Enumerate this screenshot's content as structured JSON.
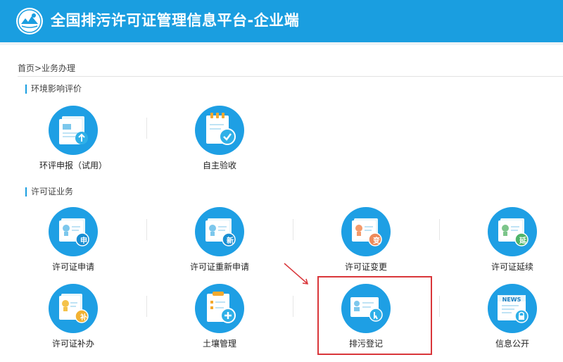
{
  "header": {
    "title": "全国排污许可证管理信息平台-企业端",
    "logo_icon": "ministry-emblem-icon"
  },
  "breadcrumb": {
    "text": "首页>业务办理"
  },
  "sections": {
    "eia": {
      "title": "环境影响评价",
      "items": [
        {
          "label": "环评申报（试用）"
        },
        {
          "label": "自主验收"
        }
      ]
    },
    "permit": {
      "title": "许可证业务",
      "items": [
        {
          "label": "许可证申请",
          "badge": "申"
        },
        {
          "label": "许可证重新申请",
          "badge": "新"
        },
        {
          "label": "许可证变更",
          "badge": "变"
        },
        {
          "label": "许可证延续",
          "badge": "延"
        },
        {
          "label": "许可证补办",
          "badge": "补"
        },
        {
          "label": "土壤管理"
        },
        {
          "label": "排污登记"
        },
        {
          "label": "信息公开",
          "badge": "NEWS"
        }
      ]
    }
  },
  "colors": {
    "header": "#1a9ee0",
    "icon_circle": "#1e9fe4",
    "highlight": "#d9363a"
  }
}
